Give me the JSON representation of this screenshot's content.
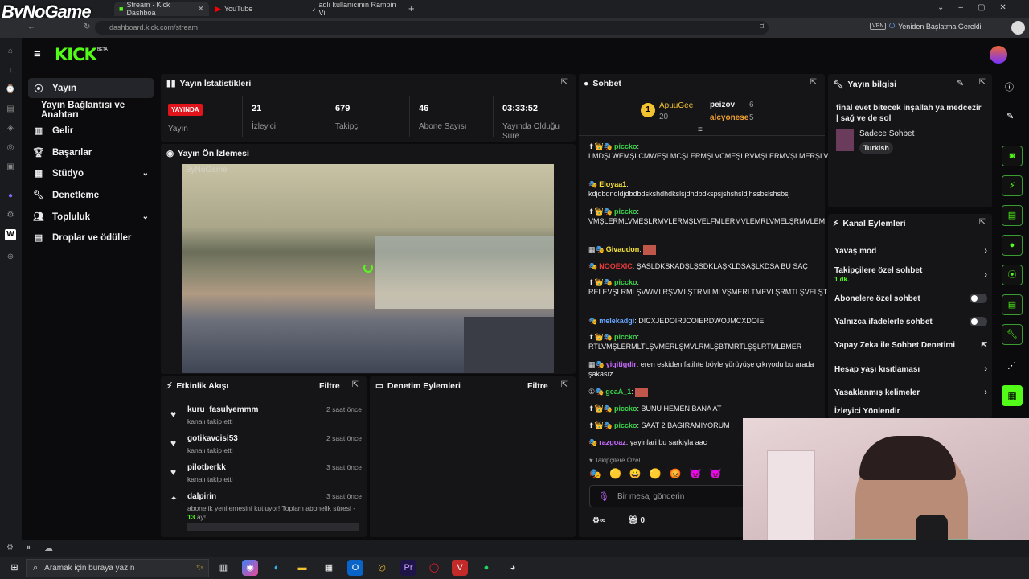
{
  "browser": {
    "tabs": [
      {
        "label": "Stream · Kick Dashboa",
        "active": true
      },
      {
        "label": "YouTube",
        "active": false
      },
      {
        "label": "adlı kullanıcının Rampin Vi",
        "active": false
      }
    ],
    "url": "dashboard.kick.com/stream",
    "restart_label": "Yeniden Başlatma Gerekli",
    "vpn_label": "VPN",
    "watermark": "ByNoGame"
  },
  "kick": {
    "logo": "KICK",
    "beta": "BETA"
  },
  "nav": [
    {
      "label": "Yayın",
      "icon": "broadcast-icon",
      "active": true
    },
    {
      "label": "Yayın Bağlantısı ve Anahtarı",
      "icon": "",
      "active": false
    },
    {
      "label": "Gelir",
      "icon": "chart-icon",
      "active": false
    },
    {
      "label": "Başarılar",
      "icon": "trophy-icon",
      "active": false
    },
    {
      "label": "Stüdyo",
      "icon": "studio-icon",
      "active": false,
      "expand": true
    },
    {
      "label": "Denetleme",
      "icon": "wrench-icon",
      "active": false
    },
    {
      "label": "Topluluk",
      "icon": "people-icon",
      "active": false,
      "expand": true
    },
    {
      "label": "Droplar ve ödüller",
      "icon": "gift-icon",
      "active": false
    }
  ],
  "stats": {
    "title": "Yayın İstatistikleri",
    "live_badge": "YAYINDA",
    "live_label": "Yayın",
    "items": [
      {
        "value": "21",
        "label": "İzleyici"
      },
      {
        "value": "679",
        "label": "Takipçi"
      },
      {
        "value": "46",
        "label": "Abone Sayısı"
      },
      {
        "value": "03:33:52",
        "label": "Yayında Olduğu Süre"
      }
    ]
  },
  "preview": {
    "title": "Yayın Ön İzlemesi",
    "overlay": "ByNoGame"
  },
  "activity": {
    "title": "Etkinlik Akışı",
    "filter": "Filtre",
    "items": [
      {
        "user": "kuru_fasulyemmm",
        "desc": "kanalı takip etti",
        "time": "2 saat önce",
        "icon": "heart-icon"
      },
      {
        "user": "gotikavcisi53",
        "desc": "kanalı takip etti",
        "time": "2 saat önce",
        "icon": "heart-icon"
      },
      {
        "user": "pilotberkk",
        "desc": "kanalı takip etti",
        "time": "3 saat önce",
        "icon": "heart-icon"
      },
      {
        "user": "dalpirin",
        "desc": "abonelik yenilemesini kutluyor! Toplam abonelik süresi -",
        "desc2": "13",
        "desc3": " ay!",
        "time": "3 saat önce",
        "icon": "star-icon"
      }
    ]
  },
  "moderation": {
    "title": "Denetim Eylemleri",
    "filter": "Filtre"
  },
  "chat": {
    "title": "Sohbet",
    "top": [
      {
        "rank": "1",
        "name": "ApuuGee",
        "count": "20"
      },
      {
        "name": "peizov",
        "count": "6"
      },
      {
        "name": "alcyonese",
        "count": "5"
      }
    ],
    "messages": [
      {
        "user": "piccko",
        "color": "#3ad64b",
        "text": "LMDŞLWEMŞLCMWEŞLMCŞLERMŞLVCMEŞLRVMŞLERMVŞLMERŞLVMLŞRMLŞV"
      },
      {
        "user": "Eloyaa1",
        "color": "#f6e23a",
        "text": "kdjdbdndldjdbdbdskshdhdkslsjdhdbdkspsjshshsldjhssbslshsbsj"
      },
      {
        "user": "piccko",
        "color": "#3ad64b",
        "text": "VMŞLERMLVMEŞLRMVLERMŞLVELFMLERMVLEMRLVMELŞRMVLEM"
      },
      {
        "user": "Givaudon",
        "color": "#f6e23a",
        "text": ""
      },
      {
        "user": "NOOEXIC",
        "color": "#e83a3a",
        "text": "ŞASLDKSKADŞLŞSDKLAŞKLDSAŞLKDSA BU SAÇ"
      },
      {
        "user": "piccko",
        "color": "#3ad64b",
        "text": "RELEVŞLRMLŞVWMLRŞVMLŞTRMLMLVŞMERLTMEVLŞRMTLŞVELŞTRMLBŞMLVEŞRMLMTLRBELŞRBRMT"
      },
      {
        "user": "melekadgi",
        "color": "#6aa7ff",
        "text": "DICXJEDOIRJCOIERDWOJMCXDOIE"
      },
      {
        "user": "piccko",
        "color": "#3ad64b",
        "text": "RTLVMŞLERMLTLŞVMERLŞMVLRMLŞBTMRTLŞŞLRTMLBMER"
      },
      {
        "user": "yigitigdir",
        "color": "#c86bff",
        "text": "eren eskiden fatihte böyle yürüyüşe çıkıyodu bu arada şakasız"
      },
      {
        "user": "geaA_1",
        "color": "#3ad64b",
        "text": ""
      },
      {
        "user": "piccko",
        "color": "#3ad64b",
        "text": "BUNU HEMEN BANA AT"
      },
      {
        "user": "piccko",
        "color": "#3ad64b",
        "text": "SAAT 2 BAGIRAMIYORUM"
      },
      {
        "user": "razgoaz",
        "color": "#c86bff",
        "text": "yayinlari bu sarkiyla aac"
      }
    ],
    "followers_only": "Takipçilere Özel",
    "input_placeholder": "Bir mesaj gönderin",
    "footer_count": "0"
  },
  "info": {
    "title": "Yayın bilgisi",
    "stream_title": "final evet bitecek inşallah ya medcezir | sağ ve de sol",
    "category": "Sadece Sohbet",
    "language": "Turkish"
  },
  "channel_actions": {
    "title": "Kanal Eylemleri",
    "rows": [
      {
        "label": "Yavaş mod",
        "type": "chevron"
      },
      {
        "label": "Takipçilere özel sohbet",
        "sub": "1 dk.",
        "type": "chevron"
      },
      {
        "label": "Abonelere özel sohbet",
        "type": "toggle"
      },
      {
        "label": "Yalnızca ifadelerle sohbet",
        "type": "toggle"
      },
      {
        "label": "Yapay Zeka ile Sohbet Denetimi",
        "type": "external"
      },
      {
        "label": "Hesap yaşı kısıtlaması",
        "type": "chevron"
      },
      {
        "label": "Yasaklanmış kelimeler",
        "type": "chevron"
      },
      {
        "label": "İzleyici Yönlendir",
        "type": "none"
      }
    ]
  },
  "taskbar": {
    "search_placeholder": "Aramak için buraya yazın"
  },
  "colors": {
    "kick_green": "#53fc18",
    "live_red": "#e1141b"
  }
}
